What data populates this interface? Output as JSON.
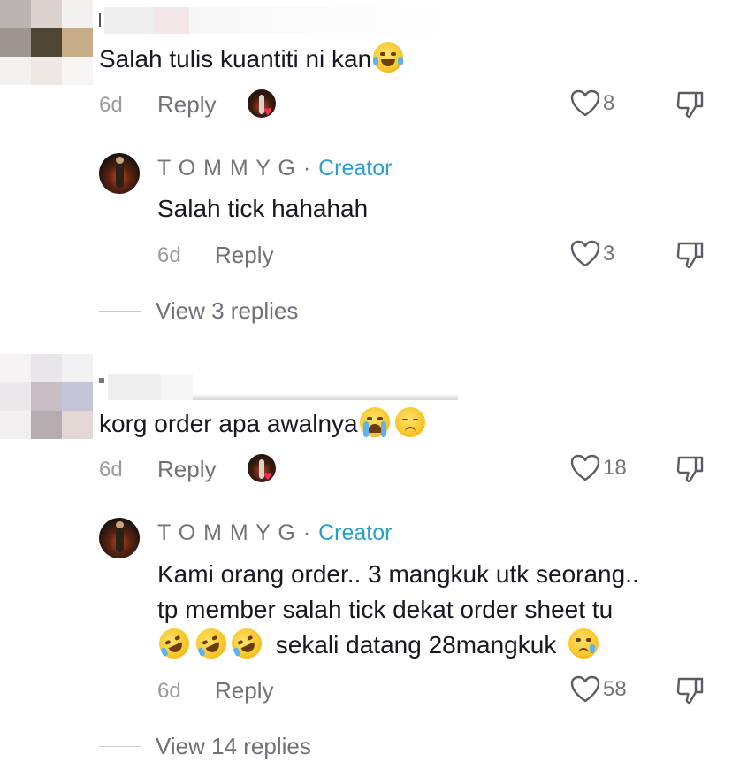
{
  "comments": [
    {
      "text": "Salah tulis kuantiti ni kan",
      "emojis": [
        "face-with-tears-of-joy"
      ],
      "time": "6d",
      "reply_label": "Reply",
      "likes": "8",
      "creator_reply": {
        "author": "T O M M Y G",
        "separator": "·",
        "badge": "Creator",
        "text": "Salah tick hahahah",
        "time": "6d",
        "reply_label": "Reply",
        "likes": "3"
      },
      "view_replies": "View 3 replies"
    },
    {
      "text": "korg order apa awalnya",
      "emojis": [
        "loudly-crying-face",
        "pensive-face"
      ],
      "time": "6d",
      "reply_label": "Reply",
      "likes": "18",
      "creator_reply": {
        "author": "T O M M Y G",
        "separator": "·",
        "badge": "Creator",
        "line1": "Kami orang order.. 3 mangkuk utk seorang..",
        "line2": "tp member salah tick dekat order sheet tu",
        "line3": "sekali datang 28mangkuk",
        "time": "6d",
        "reply_label": "Reply",
        "likes": "58"
      },
      "view_replies": "View 14 replies"
    }
  ],
  "icons": {
    "like": "heart-outline-icon",
    "dislike": "thumbs-down-outline-icon",
    "liked_by_creator": "creator-heart-icon"
  },
  "colors": {
    "creator_badge": "#2b9fcc",
    "secondary_text": "#73747b",
    "heart": "#fe2c55"
  }
}
